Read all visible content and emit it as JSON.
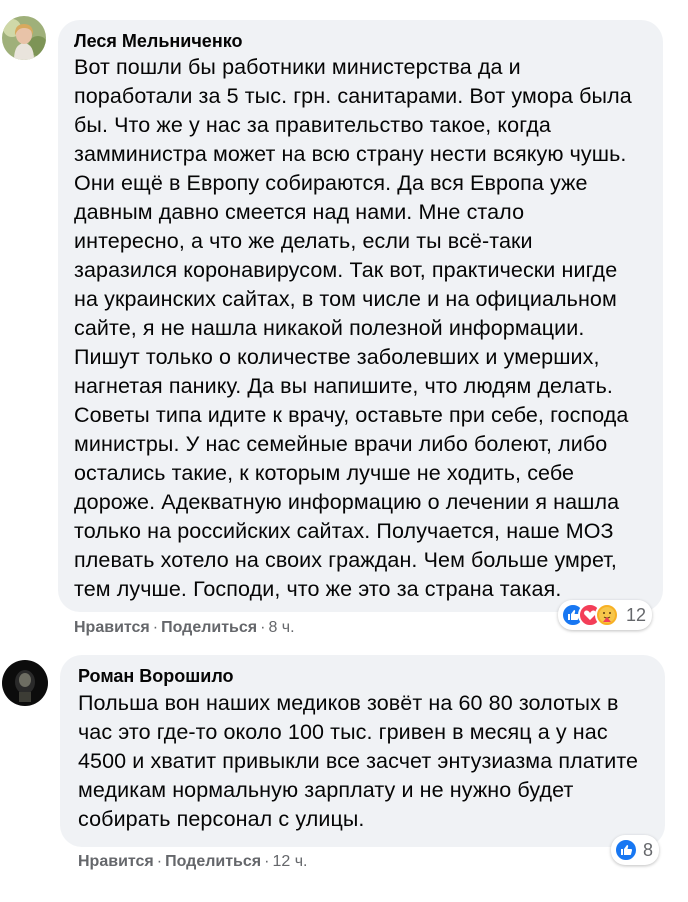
{
  "comments": [
    {
      "author": "Леся Мельниченко",
      "lines": [
        "Вот пошли бы работники министерства да и",
        "поработали за 5 тыс. грн. санитарами. Вот умора была",
        "бы. Что же у нас за правительство такое, когда",
        "замминистра может на всю страну нести всякую чушь.",
        "Они ещё в Европу собираются. Да вся Европа уже",
        "давным давно смеется над нами. Мне стало",
        "интересно, а что же делать, если ты всё-таки",
        "заразился коронавирусом. Так вот, практически нигде",
        "на украинских сайтах, в том числе и на официальном",
        "сайте, я не нашла никакой полезной информации.",
        "Пишут только о количестве заболевших и умерших,",
        "нагнетая панику. Да вы напишите, что людям делать.",
        "Советы типа идите к врачу, оставьте при себе, господа",
        "министры. У нас семейные врачи либо болеют, либо",
        "остались такие, к которым лучше не ходить, себе",
        "дороже. Адекватную информацию о лечении я нашла",
        "только на российских сайтах. Получается, наше МОЗ",
        "плевать хотело на своих граждан. Чем больше умрет,",
        "тем лучше. Господи, что же это за страна такая."
      ],
      "like_label": "Нравится",
      "share_label": "Поделиться",
      "time": "8 ч.",
      "reaction_count": "12",
      "reactions": [
        "like-icon",
        "love-icon",
        "care-icon"
      ]
    },
    {
      "author": "Роман Ворошило",
      "lines": [
        "Польша вон наших медиков зовёт на 60 80 золотых в",
        "час это где-то около 100 тыс. гривен в месяц а у нас",
        "4500 и хватит привыкли все засчет энтузиазма платите",
        "медикам нормальную зарплату и не нужно будет",
        "собирать персонал с улицы."
      ],
      "like_label": "Нравится",
      "share_label": "Поделиться",
      "time": "12 ч.",
      "reaction_count": "8",
      "reactions": [
        "like-icon"
      ]
    }
  ],
  "separator": "·",
  "colors": {
    "bubble": "#f0f2f5",
    "meta": "#65676b",
    "like": "#1877f2",
    "love": "#f33e58",
    "care": "#f7b125"
  }
}
